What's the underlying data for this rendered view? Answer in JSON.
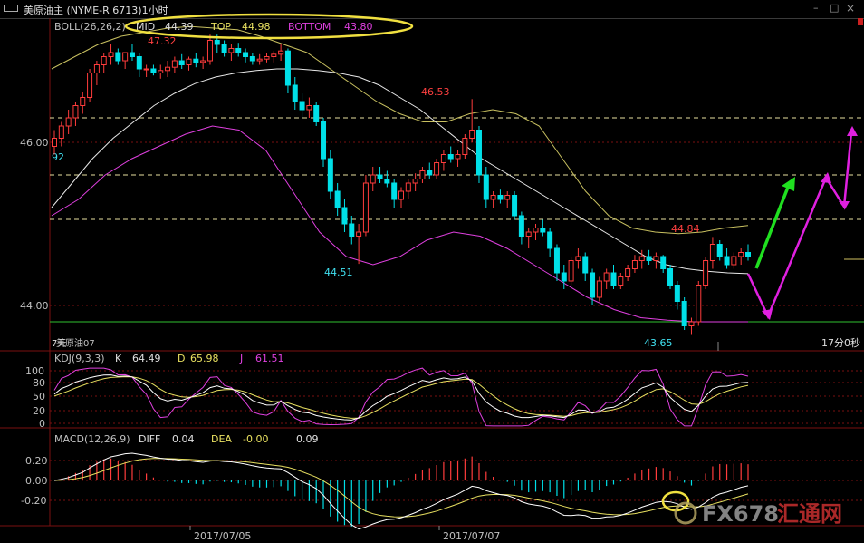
{
  "window": {
    "title": "美原油主 (NYME-R 6713)1小时",
    "controls": [
      "–",
      "□",
      "×"
    ]
  },
  "colors": {
    "background": "#000000",
    "up": "#ff3c3c",
    "down": "#00e0e8",
    "mid_line": "#e8e8e8",
    "top_line": "#c8c060",
    "bottom_line": "#e040e0",
    "grid_red": "#7a1010",
    "ellipse": "#f0e040",
    "green_arrow": "#20e020",
    "magenta_arrow": "#e020e0",
    "k_line": "#ffffff",
    "d_line": "#e8e060",
    "j_line": "#e040e0",
    "axis_text": "#c0c0c0",
    "label_red": "#ff4040",
    "label_cyan": "#40e0f0"
  },
  "boll": {
    "label": "BOLL(26,26,2)",
    "mid_label": "MID",
    "mid": "44.39",
    "top_label": "TOP",
    "top": "44.98",
    "bottom_label": "BOTTOM",
    "bottom": "43.80"
  },
  "price_axis": {
    "ticks": [
      "46.00",
      "44.00"
    ],
    "left_cut_label": "92"
  },
  "price_annotations": {
    "high1": "47.32",
    "low1": "44.51",
    "high2": "46.53",
    "high3": "44.84",
    "low2": "43.65"
  },
  "sub_label": "美原油07",
  "sub_label_prefix": "7天",
  "countdown": "17分0秒",
  "kdj": {
    "label": "KDJ(9,3,3)",
    "k_label": "K",
    "k": "64.49",
    "d_label": "D",
    "d": "65.98",
    "j_label": "J",
    "j": "61.51",
    "ticks": [
      "100",
      "80",
      "50",
      "20",
      "0"
    ]
  },
  "macd": {
    "label": "MACD(12,26,9)",
    "diff_label": "DIFF",
    "diff": "0.04",
    "dea_label": "DEA",
    "dea": "-0.00",
    "macd": "0.09",
    "ticks": [
      "0.20",
      "0.00",
      "-0.20"
    ]
  },
  "x_axis": {
    "dates": [
      "2017/07/05",
      "2017/07/07"
    ]
  },
  "watermark": {
    "text1": "FX678",
    "text2": "汇通网"
  },
  "chart_data": {
    "type": "candlestick",
    "panels": [
      "price",
      "kdj",
      "macd"
    ],
    "price_ylim": [
      43.6,
      47.5
    ],
    "candles": [
      [
        45.95,
        46.15,
        45.85,
        46.05
      ],
      [
        46.05,
        46.25,
        45.95,
        46.2
      ],
      [
        46.2,
        46.4,
        46.1,
        46.3
      ],
      [
        46.3,
        46.5,
        46.2,
        46.45
      ],
      [
        46.45,
        46.62,
        46.35,
        46.55
      ],
      [
        46.55,
        46.9,
        46.5,
        46.85
      ],
      [
        46.85,
        47.0,
        46.7,
        46.95
      ],
      [
        46.95,
        47.1,
        46.85,
        47.05
      ],
      [
        47.05,
        47.2,
        46.95,
        47.1
      ],
      [
        47.1,
        47.15,
        46.95,
        47.0
      ],
      [
        47.0,
        47.05,
        46.9,
        47.1
      ],
      [
        47.1,
        47.2,
        47.0,
        47.05
      ],
      [
        47.05,
        47.1,
        46.8,
        46.9
      ],
      [
        46.9,
        46.95,
        46.8,
        46.9
      ],
      [
        46.9,
        46.95,
        46.82,
        46.85
      ],
      [
        46.85,
        46.95,
        46.78,
        46.88
      ],
      [
        46.88,
        47.0,
        46.8,
        46.92
      ],
      [
        46.92,
        47.05,
        46.85,
        47.0
      ],
      [
        47.0,
        47.08,
        46.9,
        46.95
      ],
      [
        46.95,
        47.05,
        46.88,
        47.02
      ],
      [
        47.02,
        47.1,
        46.92,
        46.98
      ],
      [
        46.98,
        47.05,
        46.9,
        47.0
      ],
      [
        47.0,
        47.32,
        46.95,
        47.25
      ],
      [
        47.25,
        47.32,
        47.1,
        47.2
      ],
      [
        47.2,
        47.25,
        47.05,
        47.1
      ],
      [
        47.1,
        47.2,
        47.0,
        47.15
      ],
      [
        47.15,
        47.22,
        47.05,
        47.1
      ],
      [
        47.1,
        47.15,
        46.98,
        47.05
      ],
      [
        47.05,
        47.1,
        46.95,
        47.0
      ],
      [
        47.0,
        47.08,
        46.95,
        47.02
      ],
      [
        47.02,
        47.1,
        46.98,
        47.05
      ],
      [
        47.05,
        47.12,
        46.98,
        47.08
      ],
      [
        47.08,
        47.2,
        47.0,
        47.12
      ],
      [
        47.12,
        47.15,
        46.6,
        46.7
      ],
      [
        46.7,
        46.8,
        46.4,
        46.5
      ],
      [
        46.5,
        46.6,
        46.3,
        46.4
      ],
      [
        46.4,
        46.55,
        46.3,
        46.45
      ],
      [
        46.45,
        46.5,
        46.2,
        46.25
      ],
      [
        46.25,
        46.3,
        45.7,
        45.8
      ],
      [
        45.8,
        45.9,
        45.3,
        45.4
      ],
      [
        45.4,
        45.5,
        45.1,
        45.2
      ],
      [
        45.2,
        45.3,
        44.9,
        45.0
      ],
      [
        45.0,
        45.1,
        44.75,
        44.85
      ],
      [
        44.85,
        45.0,
        44.51,
        44.9
      ],
      [
        44.9,
        45.6,
        44.85,
        45.5
      ],
      [
        45.5,
        45.7,
        45.4,
        45.6
      ],
      [
        45.6,
        45.7,
        45.5,
        45.55
      ],
      [
        45.55,
        45.65,
        45.45,
        45.5
      ],
      [
        45.5,
        45.55,
        45.2,
        45.3
      ],
      [
        45.3,
        45.45,
        45.2,
        45.4
      ],
      [
        45.4,
        45.55,
        45.3,
        45.5
      ],
      [
        45.5,
        45.62,
        45.4,
        45.55
      ],
      [
        45.55,
        45.7,
        45.5,
        45.65
      ],
      [
        45.65,
        45.75,
        45.55,
        45.6
      ],
      [
        45.6,
        45.8,
        45.55,
        45.75
      ],
      [
        45.75,
        45.9,
        45.65,
        45.85
      ],
      [
        45.85,
        45.95,
        45.75,
        45.8
      ],
      [
        45.8,
        45.9,
        45.7,
        45.85
      ],
      [
        45.85,
        46.1,
        45.8,
        46.05
      ],
      [
        46.05,
        46.53,
        46.0,
        46.15
      ],
      [
        46.15,
        46.2,
        45.5,
        45.6
      ],
      [
        45.6,
        45.7,
        45.2,
        45.3
      ],
      [
        45.3,
        45.4,
        45.2,
        45.35
      ],
      [
        45.35,
        45.42,
        45.25,
        45.3
      ],
      [
        45.3,
        45.4,
        45.2,
        45.35
      ],
      [
        45.35,
        45.4,
        45.05,
        45.1
      ],
      [
        45.1,
        45.15,
        44.75,
        44.85
      ],
      [
        44.85,
        44.95,
        44.7,
        44.9
      ],
      [
        44.9,
        45.0,
        44.8,
        44.95
      ],
      [
        44.95,
        45.05,
        44.85,
        44.9
      ],
      [
        44.9,
        44.95,
        44.6,
        44.7
      ],
      [
        44.7,
        44.75,
        44.3,
        44.4
      ],
      [
        44.4,
        44.5,
        44.2,
        44.3
      ],
      [
        44.3,
        44.6,
        44.25,
        44.55
      ],
      [
        44.55,
        44.7,
        44.45,
        44.6
      ],
      [
        44.6,
        44.65,
        44.3,
        44.4
      ],
      [
        44.4,
        44.45,
        44.0,
        44.1
      ],
      [
        44.1,
        44.35,
        44.05,
        44.3
      ],
      [
        44.3,
        44.45,
        44.2,
        44.4
      ],
      [
        44.4,
        44.5,
        44.2,
        44.25
      ],
      [
        44.25,
        44.4,
        44.2,
        44.35
      ],
      [
        44.35,
        44.5,
        44.3,
        44.45
      ],
      [
        44.45,
        44.62,
        44.4,
        44.55
      ],
      [
        44.55,
        44.68,
        44.45,
        44.6
      ],
      [
        44.6,
        44.68,
        44.5,
        44.55
      ],
      [
        44.55,
        44.65,
        44.45,
        44.6
      ],
      [
        44.6,
        44.62,
        44.4,
        44.45
      ],
      [
        44.45,
        44.5,
        44.2,
        44.25
      ],
      [
        44.25,
        44.3,
        43.95,
        44.05
      ],
      [
        44.05,
        44.1,
        43.7,
        43.75
      ],
      [
        43.75,
        43.85,
        43.65,
        43.8
      ],
      [
        43.8,
        44.3,
        43.75,
        44.25
      ],
      [
        44.25,
        44.6,
        44.2,
        44.55
      ],
      [
        44.55,
        44.84,
        44.45,
        44.75
      ],
      [
        44.75,
        44.8,
        44.55,
        44.6
      ],
      [
        44.6,
        44.7,
        44.45,
        44.5
      ],
      [
        44.5,
        44.65,
        44.45,
        44.6
      ],
      [
        44.6,
        44.7,
        44.5,
        44.65
      ],
      [
        44.65,
        44.75,
        44.55,
        44.6
      ]
    ],
    "boll_mid": [
      45.2,
      45.5,
      45.8,
      46.05,
      46.25,
      46.45,
      46.6,
      46.72,
      46.8,
      46.85,
      46.88,
      46.9,
      46.9,
      46.88,
      46.85,
      46.8,
      46.7,
      46.55,
      46.4,
      46.2,
      46.0,
      45.8,
      45.65,
      45.5,
      45.35,
      45.2,
      45.05,
      44.9,
      44.75,
      44.6,
      44.5,
      44.45,
      44.42,
      44.4,
      44.39
    ],
    "boll_top": [
      46.9,
      47.05,
      47.2,
      47.3,
      47.35,
      47.4,
      47.42,
      47.4,
      47.38,
      47.3,
      47.2,
      47.1,
      46.9,
      46.7,
      46.5,
      46.35,
      46.25,
      46.25,
      46.35,
      46.4,
      46.35,
      46.2,
      45.8,
      45.4,
      45.1,
      44.95,
      44.9,
      44.88,
      44.9,
      44.95,
      44.98
    ],
    "boll_bottom": [
      45.1,
      45.3,
      45.6,
      45.8,
      45.95,
      46.1,
      46.2,
      46.15,
      45.9,
      45.4,
      44.9,
      44.6,
      44.5,
      44.6,
      44.8,
      44.9,
      44.85,
      44.7,
      44.5,
      44.3,
      44.1,
      43.95,
      43.85,
      43.82,
      43.8,
      43.8,
      43.8
    ],
    "kdj_ylim": [
      0,
      100
    ],
    "macd_ylim": [
      -0.35,
      0.3
    ]
  }
}
